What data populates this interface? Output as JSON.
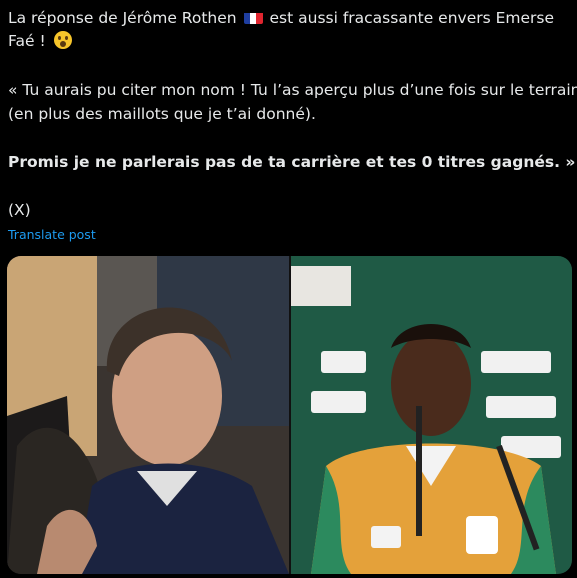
{
  "post": {
    "line1": "La réponse de Jérôme Rothen",
    "line1_after_flag": "est aussi fracassante envers Emerse",
    "line2": "Faé !",
    "quote1": "« Tu aurais pu citer mon nom ! Tu l’as aperçu plus d’une fois sur le terrain",
    "quote2": "(en plus des maillots que je t’ai donné).",
    "quote3": "Promis je ne parlerais pas de ta carrière et tes 0 titres gagnés. »",
    "source": "(X)",
    "translate_label": "Translate post"
  },
  "icons": {
    "flag": "france-flag-icon",
    "face": "hushed-face-icon",
    "speak": "speaking-head-icon"
  },
  "colors": {
    "background": "#000000",
    "text": "#e7e9ea",
    "link": "#1d9bf0",
    "flag_blue": "#1f3ea0",
    "flag_white": "#ffffff",
    "flag_red": "#e0252f"
  }
}
